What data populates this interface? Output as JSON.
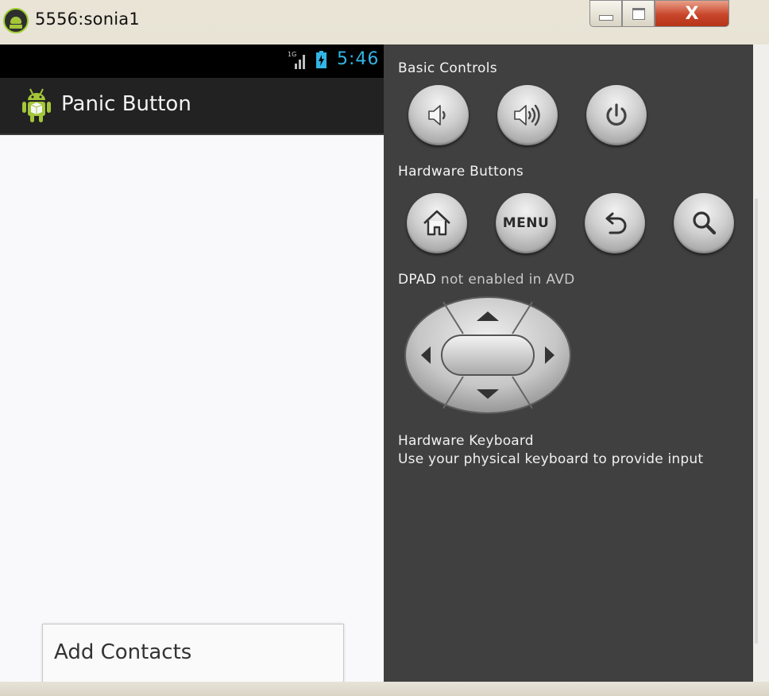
{
  "window": {
    "title": "5556:sonia1",
    "close_glyph": "X",
    "icon": "android-head-icon"
  },
  "status_bar": {
    "network": "1G",
    "clock": "5:46"
  },
  "app": {
    "title": "Panic Button",
    "icon": "android-robot-icon"
  },
  "popup_menu": {
    "items": [
      "Add Contacts"
    ]
  },
  "controls_panel": {
    "basic_controls": {
      "label": "Basic Controls",
      "buttons": [
        "volume-down-icon",
        "volume-up-icon",
        "power-icon"
      ]
    },
    "hardware_buttons": {
      "label": "Hardware Buttons",
      "buttons": [
        "home-icon",
        "MENU",
        "back-icon",
        "search-icon"
      ],
      "menu_label": "MENU"
    },
    "dpad": {
      "label_main": "DPAD",
      "label_note": "not enabled in AVD"
    },
    "keyboard": {
      "title": "Hardware Keyboard",
      "description": "Use your physical keyboard to provide input"
    }
  },
  "colors": {
    "clock": "#33b5e5",
    "panel_bg": "#404040",
    "action_bar": "#222222",
    "close_button": "#c8462b"
  }
}
